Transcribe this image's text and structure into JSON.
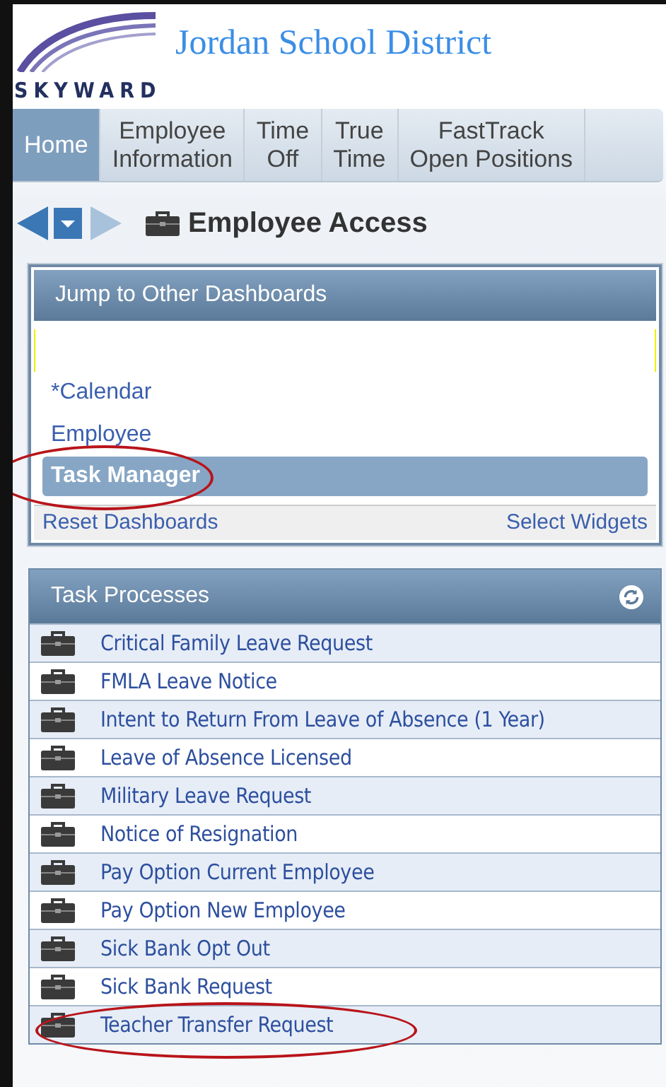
{
  "header": {
    "logo_text": "SKYWARD",
    "title": "Jordan School District"
  },
  "tabs": [
    {
      "label": "Home",
      "selected": true
    },
    {
      "label": "Employee\nInformation",
      "selected": false
    },
    {
      "label": "Time\nOff",
      "selected": false
    },
    {
      "label": "True\nTime",
      "selected": false
    },
    {
      "label": "FastTrack\nOpen Positions",
      "selected": false
    }
  ],
  "page_title": "Employee Access",
  "dashboards": {
    "title": "Jump to Other Dashboards",
    "items": [
      {
        "label": "*Calendar",
        "selected": false,
        "circled": false
      },
      {
        "label": "Employee",
        "selected": false,
        "circled": false
      },
      {
        "label": "Task Manager",
        "selected": true,
        "circled": true
      }
    ],
    "footer_links": [
      "Reset Dashboards",
      "Select Widgets"
    ]
  },
  "tasks": {
    "title": "Task Processes",
    "items": [
      {
        "label": "Critical Family Leave Request",
        "circled": false
      },
      {
        "label": "FMLA Leave Notice",
        "circled": false
      },
      {
        "label": "Intent to Return From Leave of Absence (1 Year)",
        "circled": false
      },
      {
        "label": "Leave of Absence Licensed",
        "circled": false
      },
      {
        "label": "Military Leave Request",
        "circled": false
      },
      {
        "label": "Notice of Resignation",
        "circled": false
      },
      {
        "label": "Pay Option Current Employee",
        "circled": false
      },
      {
        "label": "Pay Option New Employee",
        "circled": false
      },
      {
        "label": "Sick Bank Opt Out",
        "circled": false
      },
      {
        "label": "Sick Bank Request",
        "circled": false
      },
      {
        "label": "Teacher Transfer Request",
        "circled": true
      }
    ]
  }
}
